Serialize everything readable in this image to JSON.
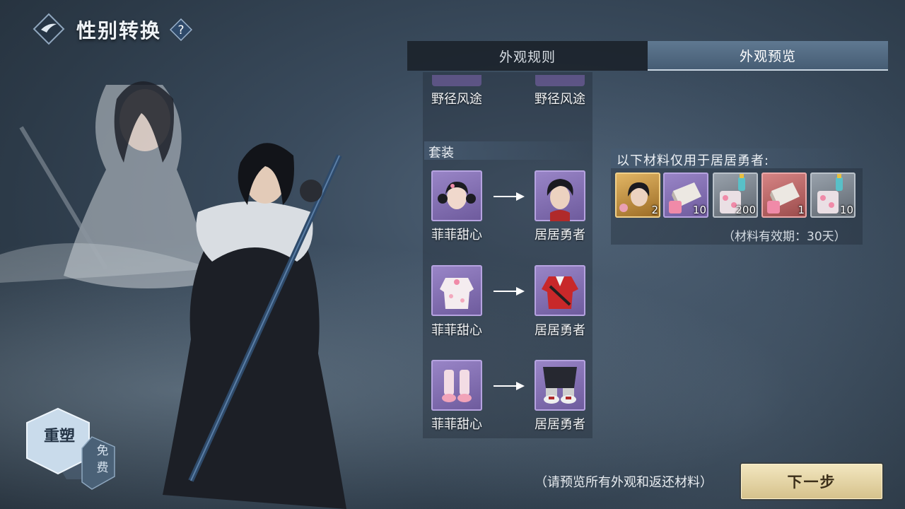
{
  "header": {
    "title": "性别转换",
    "help_symbol": "?"
  },
  "tabs": [
    {
      "label": "外观规则",
      "active": false
    },
    {
      "label": "外观预览",
      "active": true
    }
  ],
  "top_row": {
    "from_name": "野径风途",
    "to_name": "野径风途"
  },
  "section": {
    "title": "套装"
  },
  "conversions": [
    {
      "from_name": "菲菲甜心",
      "from_icon": "hair-icon-female",
      "to_name": "居居勇者",
      "to_icon": "hair-icon-male"
    },
    {
      "from_name": "菲菲甜心",
      "from_icon": "top-icon-female",
      "to_name": "居居勇者",
      "to_icon": "top-icon-male"
    },
    {
      "from_name": "菲菲甜心",
      "from_icon": "shoes-icon-female",
      "to_name": "居居勇者",
      "to_icon": "shoes-icon-male"
    }
  ],
  "materials": {
    "title": "以下材料仅用于居居勇者:",
    "items": [
      {
        "qty": "2",
        "rarity": "gold",
        "icon": "hair-material-icon"
      },
      {
        "qty": "10",
        "rarity": "purple",
        "icon": "fabric-material-icon"
      },
      {
        "qty": "200",
        "rarity": "grey",
        "icon": "dye-material-icon"
      },
      {
        "qty": "1",
        "rarity": "red",
        "icon": "fabric-material-icon"
      },
      {
        "qty": "10",
        "rarity": "grey",
        "icon": "dye-material-icon"
      }
    ],
    "expiry": "（材料有效期：30天）"
  },
  "reshape": {
    "label": "重塑",
    "free": "免费"
  },
  "footer": {
    "hint": "（请预览所有外观和返还材料）",
    "next_label": "下一步"
  },
  "colors": {
    "accent_gold": "#d6c28c",
    "tab_active": "#5f7891",
    "card_purple": "#8a76b8"
  }
}
